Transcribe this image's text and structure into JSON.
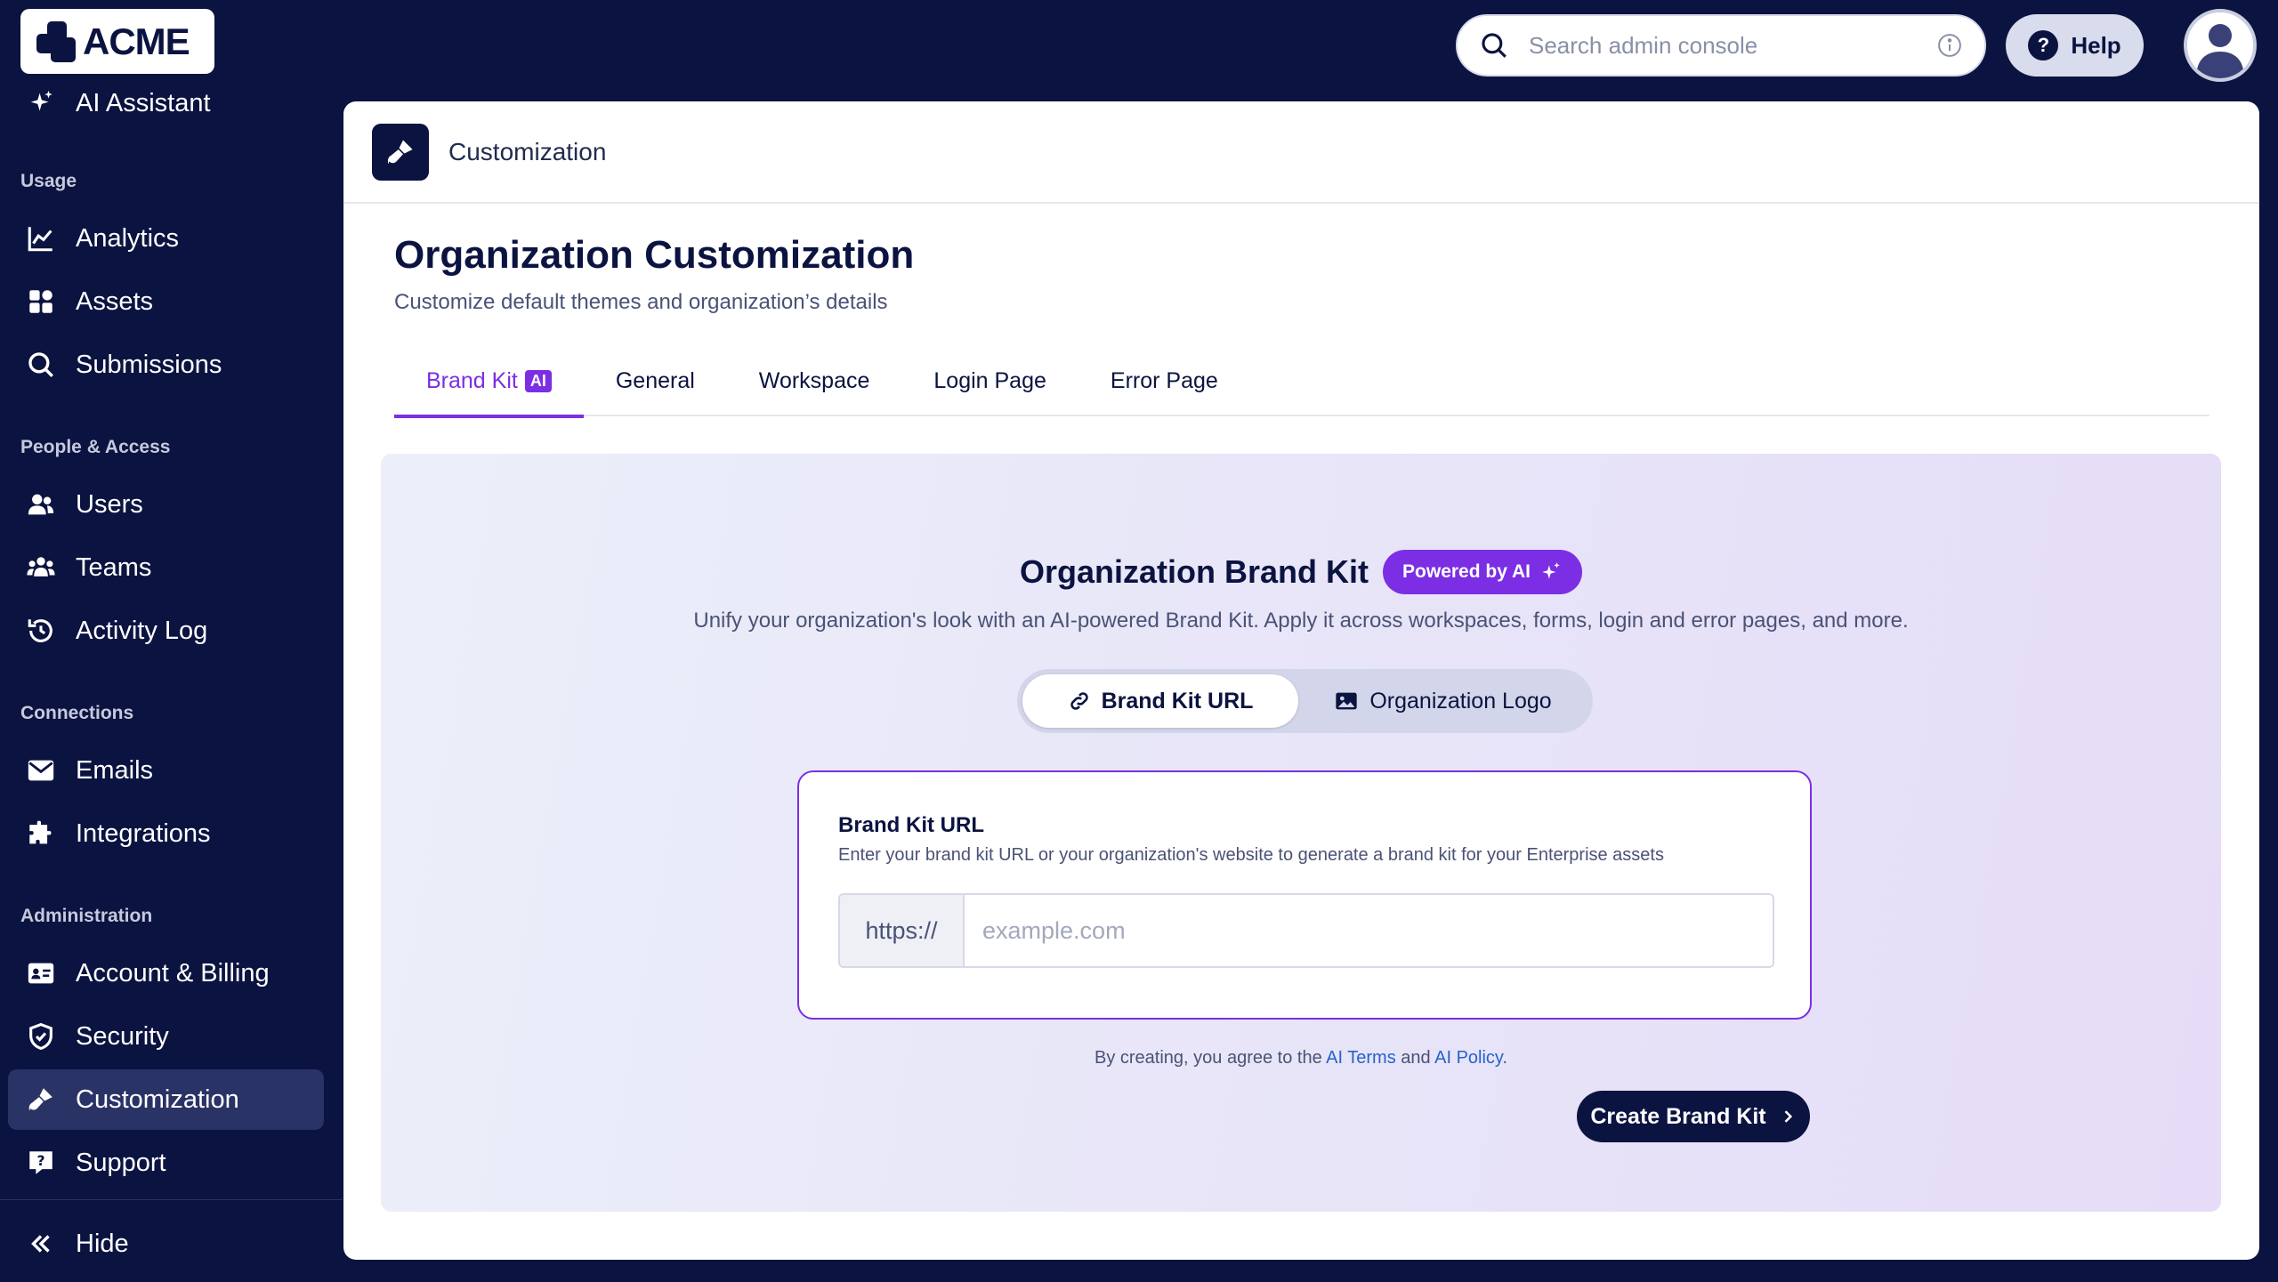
{
  "app": {
    "logo_text": "ACME"
  },
  "topbar": {
    "search_placeholder": "Search admin console",
    "help_label": "Help"
  },
  "sidebar": {
    "ai_assistant": "AI Assistant",
    "sections": {
      "usage": "Usage",
      "people": "People & Access",
      "connections": "Connections",
      "admin": "Administration"
    },
    "items": {
      "analytics": "Analytics",
      "assets": "Assets",
      "submissions": "Submissions",
      "users": "Users",
      "teams": "Teams",
      "activity_log": "Activity Log",
      "emails": "Emails",
      "integrations": "Integrations",
      "account_billing": "Account & Billing",
      "security": "Security",
      "customization": "Customization",
      "support": "Support"
    },
    "hide_label": "Hide"
  },
  "main": {
    "header_title": "Customization",
    "page_title": "Organization Customization",
    "page_subtitle": "Customize default themes and organization’s details",
    "tabs": {
      "brand_kit": "Brand Kit",
      "brand_kit_badge": "AI",
      "general": "General",
      "workspace": "Workspace",
      "login_page": "Login Page",
      "error_page": "Error Page"
    },
    "brand_kit": {
      "title": "Organization Brand Kit",
      "powered_badge": "Powered by AI",
      "description": "Unify your organization's look with an AI-powered Brand Kit. Apply it across workspaces, forms, login and error pages, and more.",
      "seg_url": "Brand Kit URL",
      "seg_logo": "Organization Logo",
      "field_label": "Brand Kit URL",
      "field_help": "Enter your brand kit URL or your organization's website to generate a brand kit for your Enterprise assets",
      "url_prefix": "https://",
      "url_placeholder": "example.com",
      "terms_prefix": "By creating, you agree to the",
      "terms_link1": "AI Terms",
      "terms_and": "and",
      "terms_link2": "AI Policy",
      "terms_suffix": ".",
      "create_button": "Create Brand Kit"
    }
  },
  "colors": {
    "navy": "#0b1340",
    "accent_purple": "#7b2ee3",
    "link_blue": "#2563c9"
  }
}
